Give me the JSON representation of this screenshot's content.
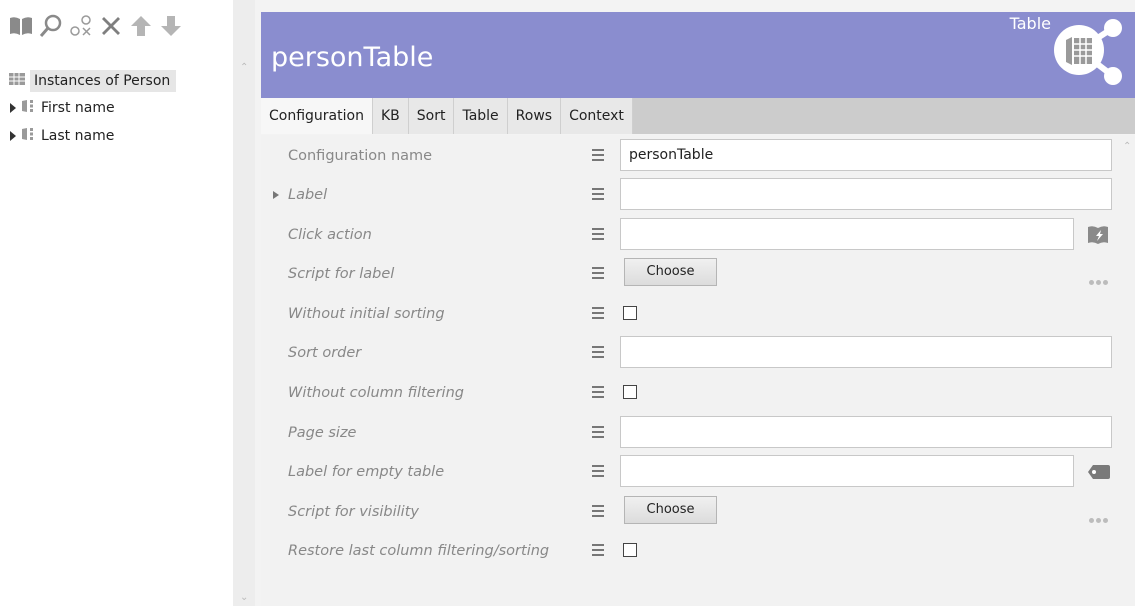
{
  "toolbar": {
    "icons": [
      "book-icon",
      "search-icon",
      "unlink-icon",
      "delete-icon",
      "move-up-icon",
      "move-down-icon"
    ]
  },
  "tree": {
    "root": {
      "label": "Instances of Person",
      "icon": "table-icon"
    },
    "items": [
      {
        "label": "First name"
      },
      {
        "label": "Last name"
      }
    ]
  },
  "header": {
    "title": "personTable",
    "type_label": "Table",
    "color": "#8a8dcf"
  },
  "tabs": [
    {
      "label": "Configuration",
      "active": true
    },
    {
      "label": "KB"
    },
    {
      "label": "Sort"
    },
    {
      "label": "Table"
    },
    {
      "label": "Rows"
    },
    {
      "label": "Context"
    }
  ],
  "form": {
    "rows": [
      {
        "label": "Configuration name",
        "value": "personTable"
      },
      {
        "label": "Label",
        "value": ""
      },
      {
        "label": "Click action",
        "value": ""
      },
      {
        "label": "Script for label",
        "button": "Choose"
      },
      {
        "label": "Without initial sorting",
        "checked": false
      },
      {
        "label": "Sort order",
        "value": ""
      },
      {
        "label": "Without column filtering",
        "checked": false
      },
      {
        "label": "Page size",
        "value": ""
      },
      {
        "label": "Label for empty table",
        "value": ""
      },
      {
        "label": "Script for visibility",
        "button": "Choose"
      },
      {
        "label": "Restore last column filtering/sorting",
        "checked": false
      }
    ]
  }
}
